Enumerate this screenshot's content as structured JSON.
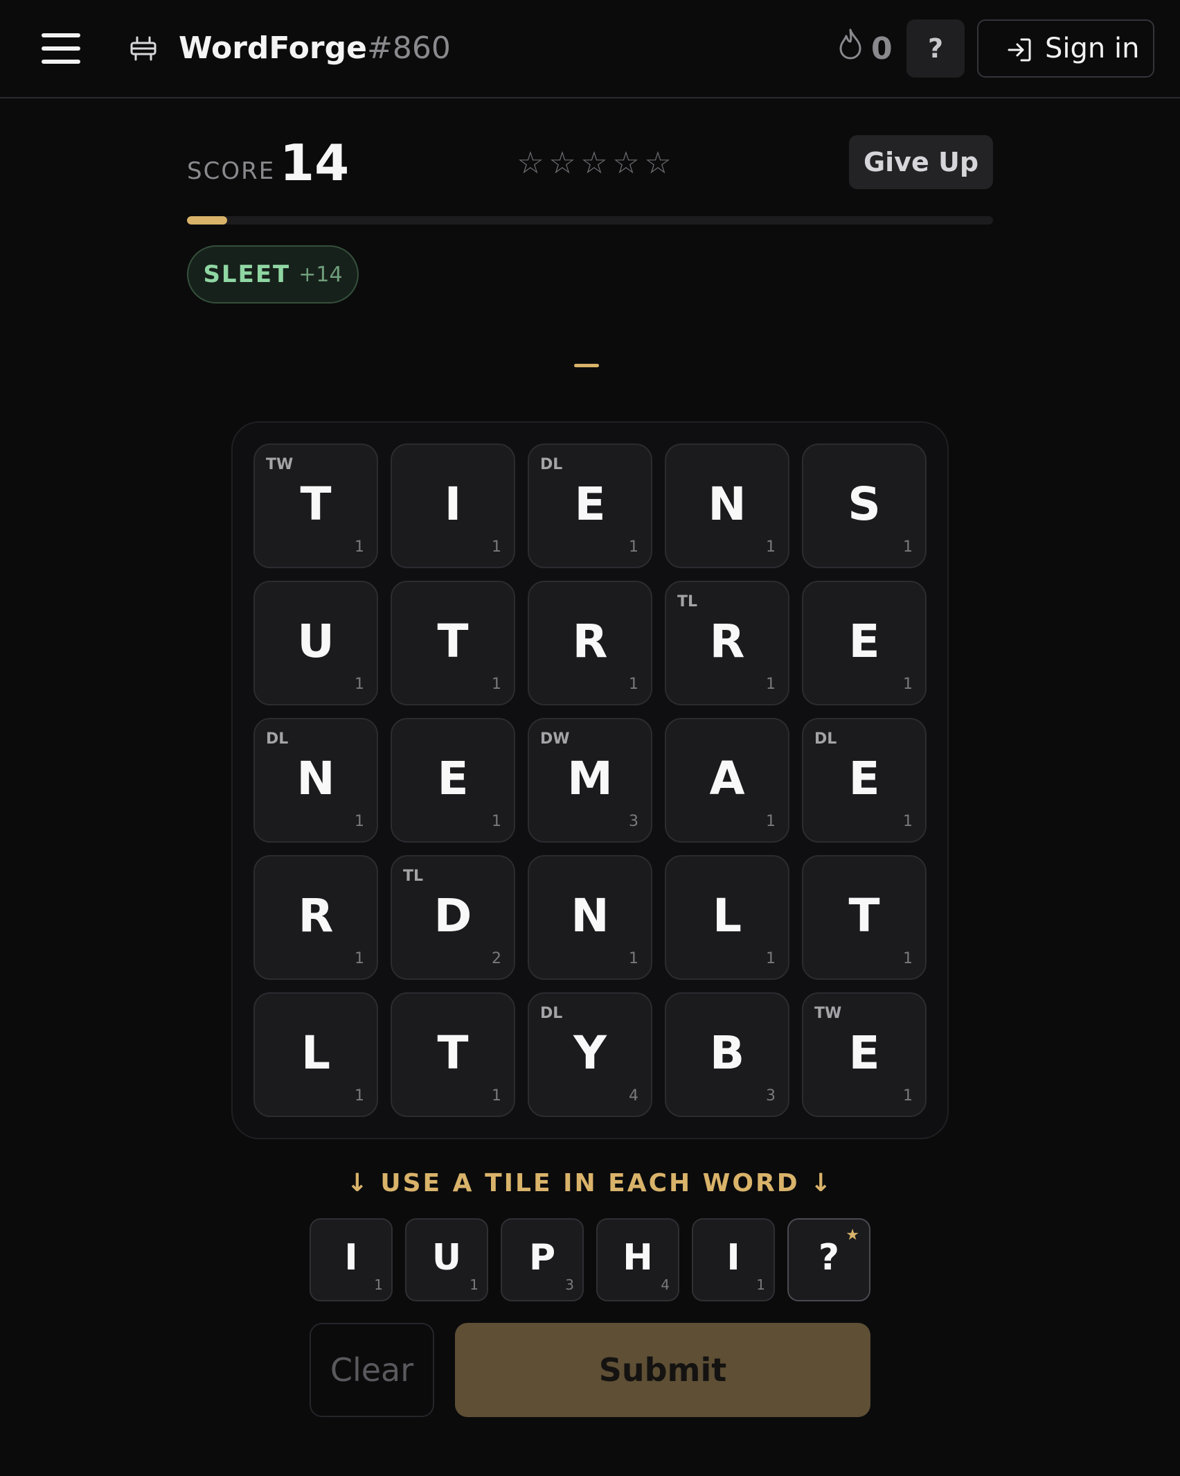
{
  "header": {
    "menu_icon": "hamburger-menu-icon",
    "logo_icon": "anvil-icon",
    "title": "WordForge",
    "puzzle_number": "#860",
    "streak_icon": "flame-icon",
    "streak_count": "0",
    "help_label": "?",
    "signin_icon": "sign-in-icon",
    "signin_label": "Sign in"
  },
  "score": {
    "label": "SCORE",
    "value": "14",
    "stars_total": 5,
    "stars_earned": 0,
    "star_glyph": "☆",
    "give_up_label": "Give Up",
    "progress_fraction": 0.05
  },
  "found_words": [
    {
      "word": "SLEET",
      "points": "+14"
    }
  ],
  "board": {
    "tiles": [
      {
        "bonus": "TW",
        "letter": "T",
        "points": "1"
      },
      {
        "bonus": "",
        "letter": "I",
        "points": "1"
      },
      {
        "bonus": "DL",
        "letter": "E",
        "points": "1"
      },
      {
        "bonus": "",
        "letter": "N",
        "points": "1"
      },
      {
        "bonus": "",
        "letter": "S",
        "points": "1"
      },
      {
        "bonus": "",
        "letter": "U",
        "points": "1"
      },
      {
        "bonus": "",
        "letter": "T",
        "points": "1"
      },
      {
        "bonus": "",
        "letter": "R",
        "points": "1"
      },
      {
        "bonus": "TL",
        "letter": "R",
        "points": "1"
      },
      {
        "bonus": "",
        "letter": "E",
        "points": "1"
      },
      {
        "bonus": "DL",
        "letter": "N",
        "points": "1"
      },
      {
        "bonus": "",
        "letter": "E",
        "points": "1"
      },
      {
        "bonus": "DW",
        "letter": "M",
        "points": "3"
      },
      {
        "bonus": "",
        "letter": "A",
        "points": "1"
      },
      {
        "bonus": "DL",
        "letter": "E",
        "points": "1"
      },
      {
        "bonus": "",
        "letter": "R",
        "points": "1"
      },
      {
        "bonus": "TL",
        "letter": "D",
        "points": "2"
      },
      {
        "bonus": "",
        "letter": "N",
        "points": "1"
      },
      {
        "bonus": "",
        "letter": "L",
        "points": "1"
      },
      {
        "bonus": "",
        "letter": "T",
        "points": "1"
      },
      {
        "bonus": "",
        "letter": "L",
        "points": "1"
      },
      {
        "bonus": "",
        "letter": "T",
        "points": "1"
      },
      {
        "bonus": "DL",
        "letter": "Y",
        "points": "4"
      },
      {
        "bonus": "",
        "letter": "B",
        "points": "3"
      },
      {
        "bonus": "TW",
        "letter": "E",
        "points": "1"
      }
    ]
  },
  "instruction": "↓ USE A TILE IN EACH WORD ↓",
  "rack": [
    {
      "letter": "I",
      "points": "1",
      "wild": false
    },
    {
      "letter": "U",
      "points": "1",
      "wild": false
    },
    {
      "letter": "P",
      "points": "3",
      "wild": false
    },
    {
      "letter": "H",
      "points": "4",
      "wild": false
    },
    {
      "letter": "I",
      "points": "1",
      "wild": false
    },
    {
      "letter": "?",
      "points": "",
      "wild": true,
      "wild_marker": "★"
    }
  ],
  "actions": {
    "clear_label": "Clear",
    "submit_label": "Submit"
  },
  "colors": {
    "background": "#0b0b0c",
    "accent": "#d9b36a",
    "found_word": "#8fd6a3",
    "submit_bg": "#5e4f35"
  }
}
